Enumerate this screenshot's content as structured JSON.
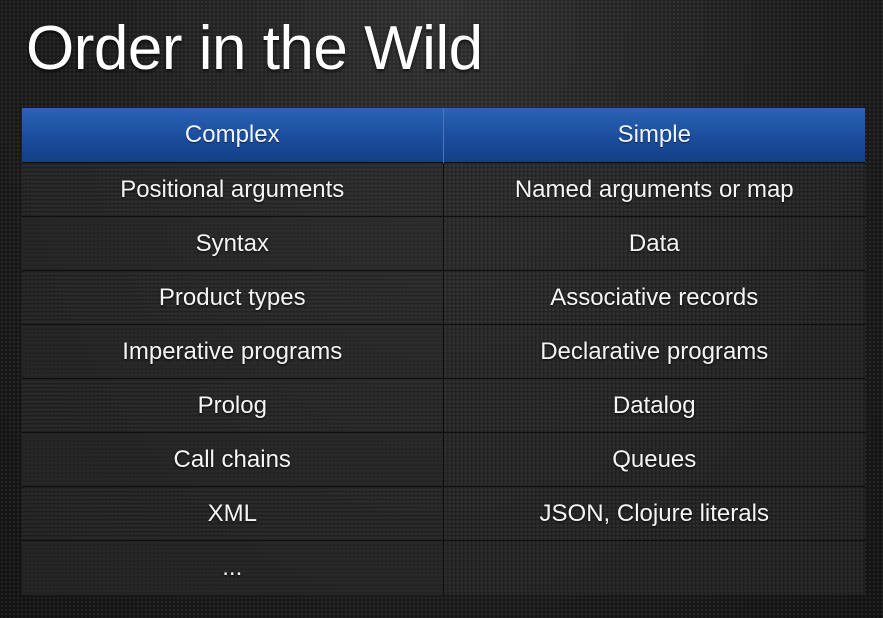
{
  "title": "Order in the Wild",
  "table": {
    "headers": [
      "Complex",
      "Simple"
    ],
    "rows": [
      [
        "Positional arguments",
        "Named arguments or map"
      ],
      [
        "Syntax",
        "Data"
      ],
      [
        "Product types",
        "Associative records"
      ],
      [
        "Imperative programs",
        "Declarative programs"
      ],
      [
        "Prolog",
        "Datalog"
      ],
      [
        "Call chains",
        "Queues"
      ],
      [
        "XML",
        "JSON, Clojure literals"
      ],
      [
        "...",
        ""
      ]
    ]
  },
  "colors": {
    "header_blue": "#1b4d9c",
    "background": "#1b1b1b",
    "text": "#ffffff"
  }
}
